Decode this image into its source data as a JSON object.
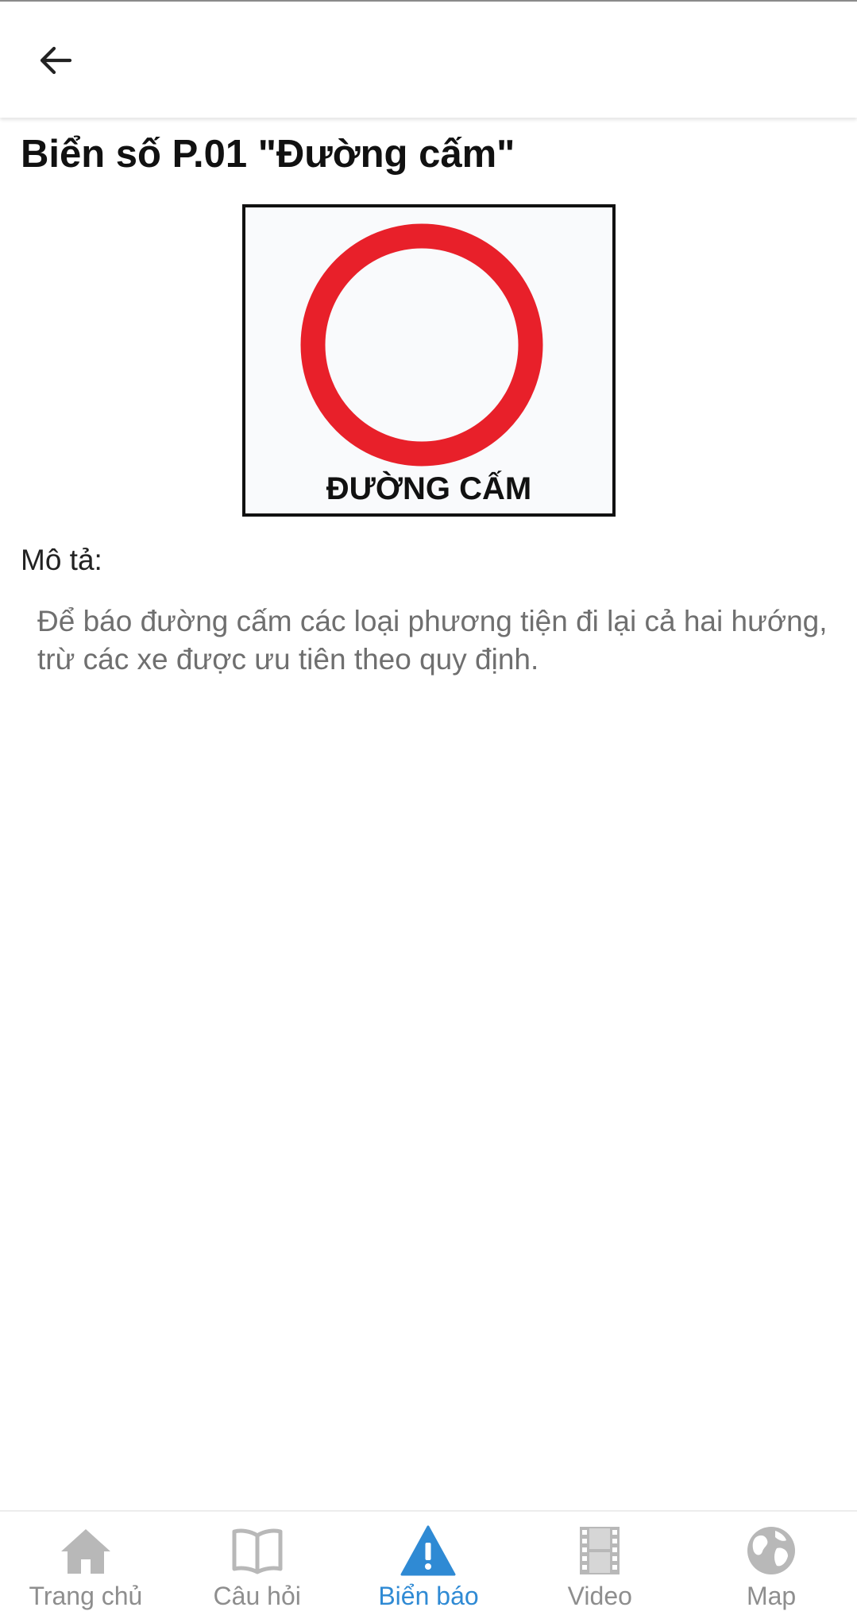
{
  "header": {
    "back_icon": "arrow-left-icon"
  },
  "title": "Biển số P.01 \"Đường cấm\"",
  "sign": {
    "caption": "ĐƯỜNG CẤM",
    "ring_color": "#e8202a",
    "frame_color": "#111111"
  },
  "description": {
    "label": "Mô tả:",
    "text": "Để báo đường cấm các loại phương tiện đi lại cả hai hướng, trừ các xe được ưu tiên theo quy định."
  },
  "bottom_nav": {
    "active_color": "#2f8ad4",
    "inactive_color": "#b8b8b8",
    "items": [
      {
        "label": "Trang chủ",
        "icon": "home-icon",
        "active": false
      },
      {
        "label": "Câu hỏi",
        "icon": "book-icon",
        "active": false
      },
      {
        "label": "Biển báo",
        "icon": "warning-triangle-icon",
        "active": true
      },
      {
        "label": "Video",
        "icon": "film-icon",
        "active": false
      },
      {
        "label": "Map",
        "icon": "globe-icon",
        "active": false
      }
    ]
  }
}
